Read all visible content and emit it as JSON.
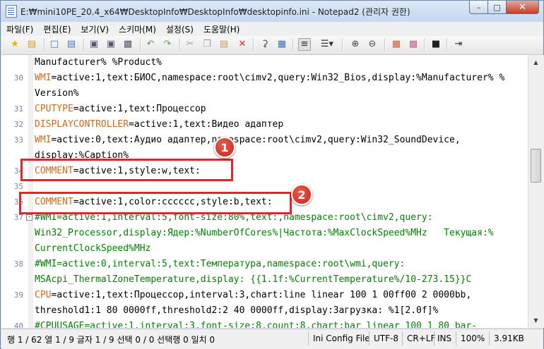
{
  "window": {
    "title": "E:₩mini10PE_20.4_x64₩DesktopInfo₩DesktopInfo₩desktopinfo.ini - Notepad2 (관리자 권한)"
  },
  "titlebar_buttons": {
    "minimize": "–",
    "maximize": "□",
    "close": "✕"
  },
  "menu": [
    "파일(F)",
    "편집(E)",
    "보기(V)",
    "스키마(M)",
    "설정(S)",
    "도움말(H)"
  ],
  "toolbar_icons": [
    "star-icon",
    "folder-open-icon",
    "new-file-icon",
    "open-file-icon",
    "save-icon",
    "save-as-icon",
    "print-icon",
    "undo-icon",
    "redo-icon",
    "cut-icon",
    "copy-icon",
    "paste-icon",
    "delete-icon",
    "find-icon",
    "replace-icon",
    "word-wrap-icon",
    "list-icon",
    "zoom-in-icon",
    "zoom-out-icon",
    "scheme-icon",
    "customize-icon",
    "console-icon",
    "exit-icon"
  ],
  "editor": {
    "lines": [
      {
        "num": "",
        "key": "",
        "rest": "Manufacturer% %Product%"
      },
      {
        "num": "30",
        "key": "WMI",
        "rest": "=active:1,text:БИОС,namespace:root\\cimv2,query:Win32_Bios,display:%Manufacturer% %"
      },
      {
        "num": "",
        "key": "",
        "rest": "Version%"
      },
      {
        "num": "31",
        "key": "CPUTYPE",
        "rest": "=active:1,text:Процессор"
      },
      {
        "num": "32",
        "key": "DISPLAYCONTROLLER",
        "rest": "=active:1,text:Видео адаптер"
      },
      {
        "num": "33",
        "key": "WMI",
        "rest": "=active:0,text:Аудио адаптер,namespace:root\\cimv2,query:Win32_SoundDevice,"
      },
      {
        "num": "",
        "key": "",
        "rest": "display:%Caption%"
      },
      {
        "num": "34",
        "key": "COMMENT",
        "rest": "=active:1,style:w,text:"
      },
      {
        "num": "35",
        "key": "",
        "rest": ""
      },
      {
        "num": "36",
        "key": "COMMENT",
        "rest": "=active:1,color:cccccc,style:b,text:"
      },
      {
        "num": "37",
        "key": "",
        "rest": "#WMI=active:1,interval:5,font-size:80%,text:,namespace:root\\cimv2,query:",
        "comment": true
      },
      {
        "num": "",
        "key": "",
        "rest": "Win32_Processor,display:Ядер:%NumberOfCores%|Частота:%MaxClockSpeed%MHz   Текущая:%",
        "comment": true
      },
      {
        "num": "",
        "key": "",
        "rest": "CurrentClockSpeed%MHz",
        "comment": true
      },
      {
        "num": "38",
        "key": "",
        "rest": "#WMI=active:0,interval:5,text:Температура,namespace:root\\wmi,query:",
        "comment": true
      },
      {
        "num": "",
        "key": "",
        "rest": "MSAcpi_ThermalZoneTemperature,display: {{1.1f:%CurrentTemperature%/10-273.15}}C",
        "comment": true
      },
      {
        "num": "39",
        "key": "CPU",
        "rest": "=active:1,text:Процессор,interval:3,chart:line linear 100 1 00ff00 2 0000bb,"
      },
      {
        "num": "",
        "key": "",
        "rest": "threshold1:1 80 0000ff,threshold2:2 40 0000ff,display:Загрузка: %1[2.0f]%"
      },
      {
        "num": "40",
        "key": "",
        "rest": "#CPUUSAGE=active:1,interval:3,font-size:8,count:8,chart:bar linear 100 1 80 bar-",
        "comment": true
      }
    ]
  },
  "annotations": {
    "badge1": "1",
    "badge2": "2"
  },
  "status": {
    "position": "행 1 / 62  열 1 / 9  글자 1 / 9  선택 0 / 0  선택행 0  일치 0",
    "scheme": "Ini Config File",
    "encoding": "UTF-8",
    "eol": "CR+LF",
    "ins": "INS",
    "zoom": "100%",
    "size": "3.91KB"
  },
  "colors": {
    "key": "#d2691e",
    "comment": "#008000",
    "annotation": "#e0262b"
  }
}
